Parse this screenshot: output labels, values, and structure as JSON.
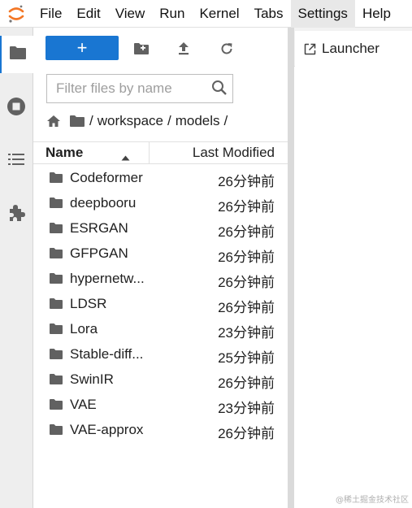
{
  "menubar": {
    "items": [
      "File",
      "Edit",
      "View",
      "Run",
      "Kernel",
      "Tabs",
      "Settings",
      "Help"
    ],
    "active_item": "Settings"
  },
  "activity_bar": {
    "icons": [
      "folder-icon",
      "running-stop-icon",
      "table-of-contents-icon",
      "extension-puzzle-icon"
    ]
  },
  "file_browser": {
    "new_launcher_label": "+",
    "toolbar_icons": [
      "new-folder-icon",
      "upload-icon",
      "refresh-icon"
    ],
    "filter_placeholder": "Filter files by name",
    "breadcrumb": {
      "separator": "/",
      "parts": [
        "workspace",
        "models"
      ]
    },
    "columns": {
      "name": "Name",
      "modified": "Last Modified"
    },
    "files": [
      {
        "name": "Codeformer",
        "modified": "26分钟前"
      },
      {
        "name": "deepbooru",
        "modified": "26分钟前"
      },
      {
        "name": "ESRGAN",
        "modified": "26分钟前"
      },
      {
        "name": "GFPGAN",
        "modified": "26分钟前"
      },
      {
        "name": "hypernetw...",
        "modified": "26分钟前"
      },
      {
        "name": "LDSR",
        "modified": "26分钟前"
      },
      {
        "name": "Lora",
        "modified": "23分钟前"
      },
      {
        "name": "Stable-diff...",
        "modified": "25分钟前"
      },
      {
        "name": "SwinIR",
        "modified": "26分钟前"
      },
      {
        "name": "VAE",
        "modified": "23分钟前"
      },
      {
        "name": "VAE-approx",
        "modified": "26分钟前"
      }
    ]
  },
  "main_area": {
    "tab_label": "Launcher"
  },
  "watermark": "@稀土掘金技术社区",
  "colors": {
    "accent": "#1976d2",
    "logo_orange": "#f37726",
    "icon_gray": "#616161"
  }
}
